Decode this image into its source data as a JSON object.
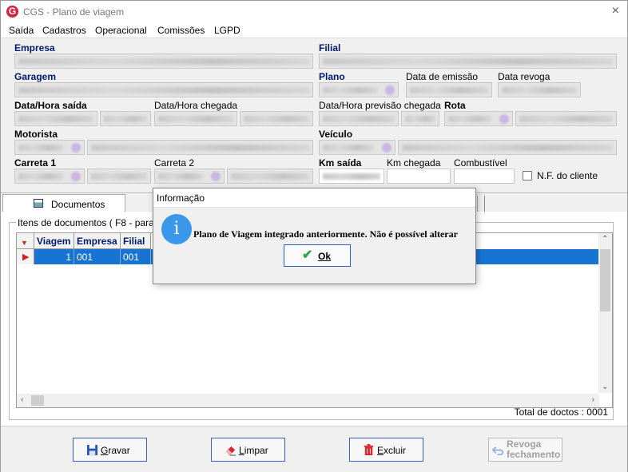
{
  "window": {
    "app_badge": "G",
    "title": "CGS - Plano de viagem",
    "close": "×"
  },
  "menu": [
    "Saída",
    "Cadastros",
    "Operacional",
    "Comissões",
    "LGPD"
  ],
  "form": {
    "empresa": "Empresa",
    "filial": "Filial",
    "garagem": "Garagem",
    "plano": "Plano",
    "data_emissao": "Data de emissão",
    "data_revoga": "Data revoga",
    "data_hora_saida": "Data/Hora saída",
    "data_hora_chegada": "Data/Hora chegada",
    "data_hora_previsao": "Data/Hora previsão chegada",
    "rota": "Rota",
    "motorista": "Motorista",
    "veiculo": "Veículo",
    "carreta1": "Carreta 1",
    "carreta2": "Carreta 2",
    "km_saida": "Km saída",
    "km_chegada": "Km chegada",
    "combustivel": "Combustível",
    "nf_cliente": "N.F. do cliente"
  },
  "tabs": {
    "documentos": "Documentos"
  },
  "documents": {
    "group_title": "Itens de documentos ( F8 - para sa",
    "columns": [
      "Viagem",
      "Empresa",
      "Filial"
    ],
    "rows": [
      {
        "viagem": "1",
        "empresa": "001",
        "filial": "001"
      }
    ],
    "total": "Total de doctos : 0001"
  },
  "buttons": {
    "gravar": "Gravar",
    "limpar": "Limpar",
    "excluir": "Excluir",
    "revoga_line1": "Revoga",
    "revoga_line2": "fechamento"
  },
  "dialog": {
    "title": "Informação",
    "icon": "i",
    "message": "Plano de Viagem integrado anteriormente. Não é possível alterar",
    "ok": "Ok"
  }
}
